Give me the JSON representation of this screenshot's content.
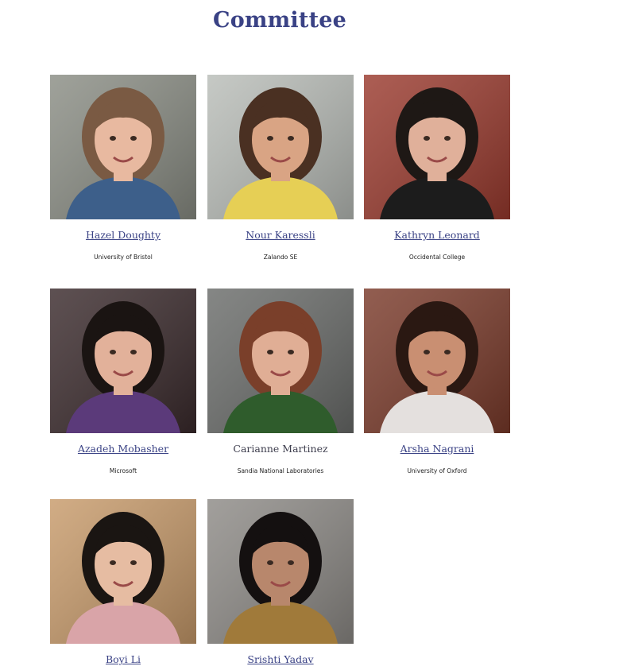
{
  "title": "Committee",
  "members": [
    {
      "name": "Hazel Doughty",
      "affiliation": "University of Bristol",
      "linked": true,
      "bg": "#8a8d84",
      "skin": "#e8b9a0",
      "hair": "#7a5a43",
      "shirt": "#3d5f8a"
    },
    {
      "name": "Nour Karessli",
      "affiliation": "Zalando SE",
      "linked": true,
      "bg": "#b9bdb8",
      "skin": "#d9a484",
      "hair": "#4a3022",
      "shirt": "#e6cf55"
    },
    {
      "name": "Kathryn Leonard",
      "affiliation": "Occidental College",
      "linked": true,
      "bg": "#9a3a2e",
      "skin": "#e0b09a",
      "hair": "#1e1815",
      "shirt": "#1c1c1c"
    },
    {
      "name": "Azadeh Mobasher",
      "affiliation": "Microsoft",
      "linked": true,
      "bg": "#3a2a2c",
      "skin": "#e2b19a",
      "hair": "#1a1412",
      "shirt": "#5b3a7a"
    },
    {
      "name": "Carianne  Martinez",
      "affiliation": "Sandia National Laboratories",
      "linked": false,
      "bg": "#6a6c6a",
      "skin": "#e0ae95",
      "hair": "#7a3f2a",
      "shirt": "#2f5c2c"
    },
    {
      "name": "Arsha Nagrani",
      "affiliation": "University of Oxford",
      "linked": true,
      "bg": "#7a3a2a",
      "skin": "#c98f72",
      "hair": "#2a1812",
      "shirt": "#e4e0de"
    },
    {
      "name": "Boyi Li",
      "affiliation": "",
      "linked": true,
      "bg": "#c79a6a",
      "skin": "#e6bca2",
      "hair": "#1a1512",
      "shirt": "#d9a4a8"
    },
    {
      "name": "Srishti Yadav",
      "affiliation": "",
      "linked": true,
      "bg": "#8d8a86",
      "skin": "#b8876c",
      "hair": "#141010",
      "shirt": "#a07a3a"
    }
  ]
}
